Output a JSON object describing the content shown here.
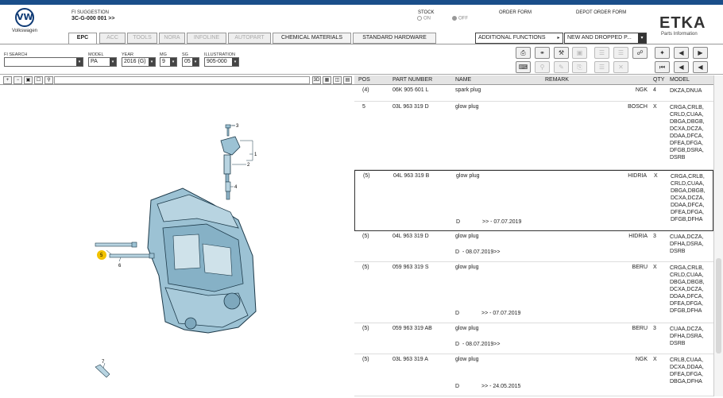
{
  "header": {
    "brand": "Volkswagen",
    "fi_suggestion_label": "FI SUGGESTION",
    "fi_suggestion_value": "3C-G-000 001 >>",
    "stock_label": "STOCK",
    "stock_on": "ON",
    "stock_off": "OFF",
    "order_form": "ORDER FORM",
    "depot_order_form": "DEPOT ORDER FORM",
    "app_name": "ETKA",
    "app_sub": "Parts Information"
  },
  "tabs": [
    {
      "label": "EPC"
    },
    {
      "label": "ACC"
    },
    {
      "label": "TOOLS"
    },
    {
      "label": "NORA"
    },
    {
      "label": "INFOLINE"
    },
    {
      "label": "AUTOPART"
    },
    {
      "label": "CHEMICAL MATERIALS"
    },
    {
      "label": "STANDARD HARDWARE"
    }
  ],
  "menus": {
    "additional_functions": "ADDITIONAL FUNCTIONS",
    "new_and_dropped": "NEW AND DROPPED P..."
  },
  "filters": {
    "fi_search_label": "FI SEARCH",
    "fi_search_value": "",
    "model_label": "MODEL",
    "model_value": "PA",
    "year_label": "YEAR",
    "year_value": "2016 (G)",
    "mg_label": "MG",
    "mg_value": "9",
    "sg_label": "SG",
    "sg_value": "05",
    "illustration_label": "ILLUSTRATION",
    "illustration_value": "905-000"
  },
  "grid": {
    "columns": {
      "pos": "POS",
      "part_number": "PART NUMBER",
      "name": "NAME",
      "remark": "REMARK",
      "qty": "QTY",
      "model": "MODEL"
    },
    "rows": [
      {
        "pos": "(4)",
        "part": "06K 905 601 L",
        "name": "spark plug",
        "remark": "NGK",
        "qty": "4",
        "models": "DKZA,DNUA",
        "note_d": "",
        "note_text": ""
      },
      {
        "pos": "5",
        "part": "03L 963 319 D",
        "name": "glow plug",
        "remark": "BOSCH",
        "qty": "X",
        "models": "CRGA,CRLB, CRLD,CUAA, DBGA,DBGB, DCXA,DCZA, DDAA,DFCA, DFEA,DFGA, DFGB,DSRA, DSRB",
        "note_d": "",
        "note_text": ""
      },
      {
        "pos": "(5)",
        "part": "04L 963 319 B",
        "name": "glow plug",
        "remark": "HIDRIA",
        "qty": "X",
        "models": "CRGA,CRLB, CRLD,CUAA, DBGA,DBGB, DCXA,DCZA, DDAA,DFCA, DFEA,DFGA, DFGB,DFHA",
        "note_d": "D",
        "note_text": ">> - 07.07.2019"
      },
      {
        "pos": "(5)",
        "part": "04L 963 319 D",
        "name": "glow plug",
        "remark": "HIDRIA",
        "qty": "3",
        "models": "CUAA,DCZA, DFHA,DSRA, DSRB",
        "note_d": "D",
        "note_text": "- 08.07.2019>>"
      },
      {
        "pos": "(5)",
        "part": "059 963 319 S",
        "name": "glow plug",
        "remark": "BERU",
        "qty": "X",
        "models": "CRGA,CRLB, CRLD,CUAA, DBGA,DBGB, DCXA,DCZA, DDAA,DFCA, DFEA,DFGA, DFGB,DFHA",
        "note_d": "D",
        "note_text": ">> - 07.07.2019"
      },
      {
        "pos": "(5)",
        "part": "059 963 319 AB",
        "name": "glow plug",
        "remark": "BERU",
        "qty": "3",
        "models": "CUAA,DCZA, DFHA,DSRA, DSRB",
        "note_d": "D",
        "note_text": "- 08.07.2019>>"
      },
      {
        "pos": "(5)",
        "part": "03L 963 319 A",
        "name": "glow plug",
        "remark": "NGK",
        "qty": "X",
        "models": "CRLB,CUAA, DCXA,DDAA, DFEA,DFGA, DBGA,DFHA",
        "note_d": "D",
        "note_text": ">> - 24.05.2015"
      }
    ]
  },
  "illustration": {
    "callouts": [
      "3",
      "1",
      "2",
      "4",
      "5",
      "6",
      "7"
    ]
  }
}
